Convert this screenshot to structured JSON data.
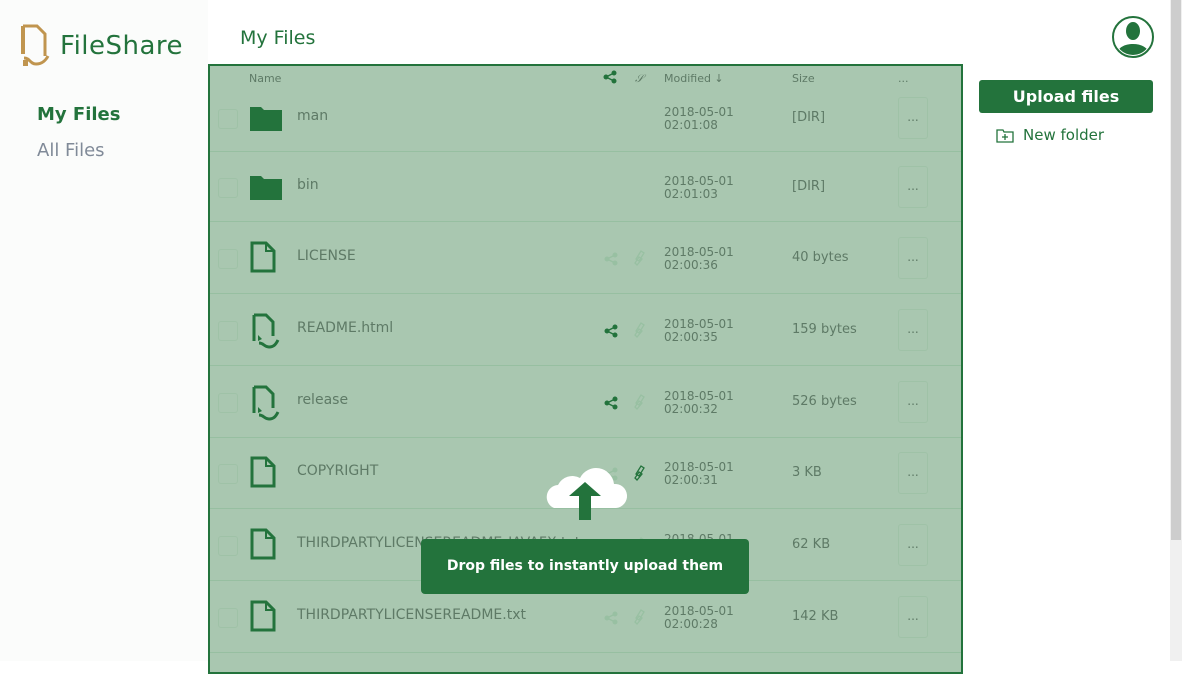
{
  "app": {
    "name": "FileShare"
  },
  "sidebar": {
    "items": [
      {
        "label": "My Files",
        "active": true
      },
      {
        "label": "All Files",
        "active": false
      }
    ]
  },
  "header": {
    "title": "My Files"
  },
  "table": {
    "columns": {
      "name": "Name",
      "modified": "Modified ↓",
      "size": "Size",
      "actions": "..."
    },
    "rows": [
      {
        "type": "folder",
        "name": "man",
        "date": "2018-05-01",
        "time": "02:01:08",
        "size": "[DIR]",
        "shared": null,
        "linked": null
      },
      {
        "type": "folder",
        "name": "bin",
        "date": "2018-05-01",
        "time": "02:01:03",
        "size": "[DIR]",
        "shared": null,
        "linked": null
      },
      {
        "type": "file",
        "name": "LICENSE",
        "date": "2018-05-01",
        "time": "02:00:36",
        "size": "40 bytes",
        "shared": false,
        "linked": false
      },
      {
        "type": "shared-file",
        "name": "README.html",
        "date": "2018-05-01",
        "time": "02:00:35",
        "size": "159 bytes",
        "shared": true,
        "linked": false
      },
      {
        "type": "shared-file",
        "name": "release",
        "date": "2018-05-01",
        "time": "02:00:32",
        "size": "526 bytes",
        "shared": true,
        "linked": false
      },
      {
        "type": "file",
        "name": "COPYRIGHT",
        "date": "2018-05-01",
        "time": "02:00:31",
        "size": "3 KB",
        "shared": false,
        "linked": true
      },
      {
        "type": "file",
        "name": "THIRDPARTYLICENSEREADME-JAVAFX.txt",
        "date": "2018-05-01",
        "time": "02:00:30",
        "size": "62 KB",
        "shared": false,
        "linked": false
      },
      {
        "type": "file",
        "name": "THIRDPARTYLICENSEREADME.txt",
        "date": "2018-05-01",
        "time": "02:00:28",
        "size": "142 KB",
        "shared": false,
        "linked": false
      }
    ],
    "more_label": "..."
  },
  "dropzone": {
    "message": "Drop files to instantly upload them"
  },
  "actions": {
    "upload": "Upload files",
    "new_folder": "New folder"
  },
  "colors": {
    "accent": "#23733c",
    "logo": "#c0954f",
    "overlay": "#a9c7b0"
  }
}
